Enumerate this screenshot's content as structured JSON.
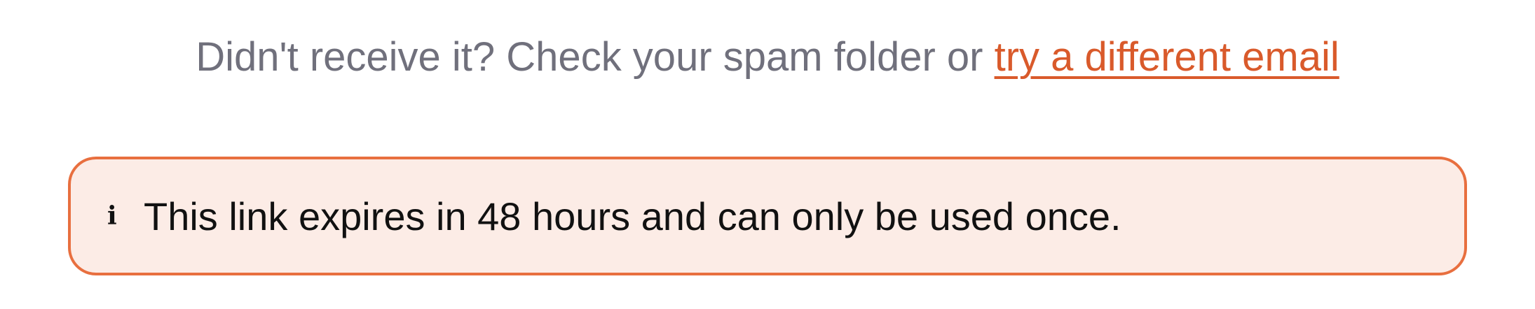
{
  "help": {
    "text": "Didn't receive it? Check your spam folder or ",
    "link_label": "try a different email"
  },
  "notice": {
    "icon": "info-icon",
    "icon_glyph": "i",
    "message": "This link expires in 48 hours and can only be used once."
  },
  "colors": {
    "accent": "#d95a2b",
    "notice_border": "#e86f3f",
    "notice_background": "#fcece6",
    "muted_text": "#70707c"
  }
}
